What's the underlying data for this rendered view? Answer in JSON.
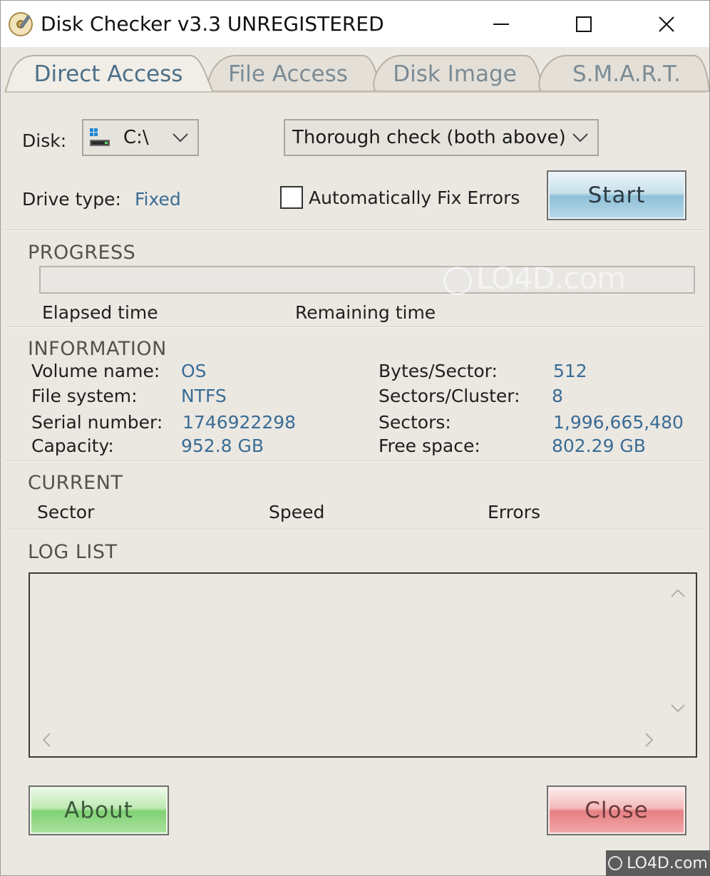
{
  "window": {
    "title": "Disk Checker v3.3 UNREGISTERED"
  },
  "tabs": [
    {
      "label": "Direct Access",
      "active": true
    },
    {
      "label": "File Access",
      "active": false
    },
    {
      "label": "Disk Image",
      "active": false
    },
    {
      "label": "S.M.A.R.T.",
      "active": false
    }
  ],
  "form": {
    "disk_label": "Disk:",
    "disk_value": "C:\\",
    "mode_value": "Thorough check (both above)",
    "drive_type_label": "Drive type:",
    "drive_type_value": "Fixed",
    "auto_fix_label": "Automatically Fix Errors",
    "auto_fix_checked": false,
    "start_label": "Start"
  },
  "progress": {
    "title": "PROGRESS",
    "value": 0,
    "elapsed_label": "Elapsed time",
    "remaining_label": "Remaining time"
  },
  "information": {
    "title": "INFORMATION",
    "volume_name_label": "Volume name:",
    "volume_name_value": "OS",
    "file_system_label": "File system:",
    "file_system_value": "NTFS",
    "serial_number_label": "Serial number:",
    "serial_number_value": "1746922298",
    "capacity_label": "Capacity:",
    "capacity_value": "952.8 GB",
    "bytes_per_sector_label": "Bytes/Sector:",
    "bytes_per_sector_value": "512",
    "sectors_per_cluster_label": "Sectors/Cluster:",
    "sectors_per_cluster_value": "8",
    "sectors_label": "Sectors:",
    "sectors_value": "1,996,665,480",
    "free_space_label": "Free space:",
    "free_space_value": "802.29 GB"
  },
  "current": {
    "title": "CURRENT",
    "sector_label": "Sector",
    "speed_label": "Speed",
    "errors_label": "Errors"
  },
  "log": {
    "title": "LOG LIST"
  },
  "buttons": {
    "about_label": "About",
    "close_label": "Close"
  },
  "watermark": {
    "text": "LO4D.com"
  },
  "colors": {
    "window_bg": "#ebe8e2",
    "value_text": "#3a6c95",
    "tab_active": "#4c6f88",
    "start_button": "#8fc0d8",
    "about_button": "#7fd174",
    "close_button": "#e67f82"
  }
}
